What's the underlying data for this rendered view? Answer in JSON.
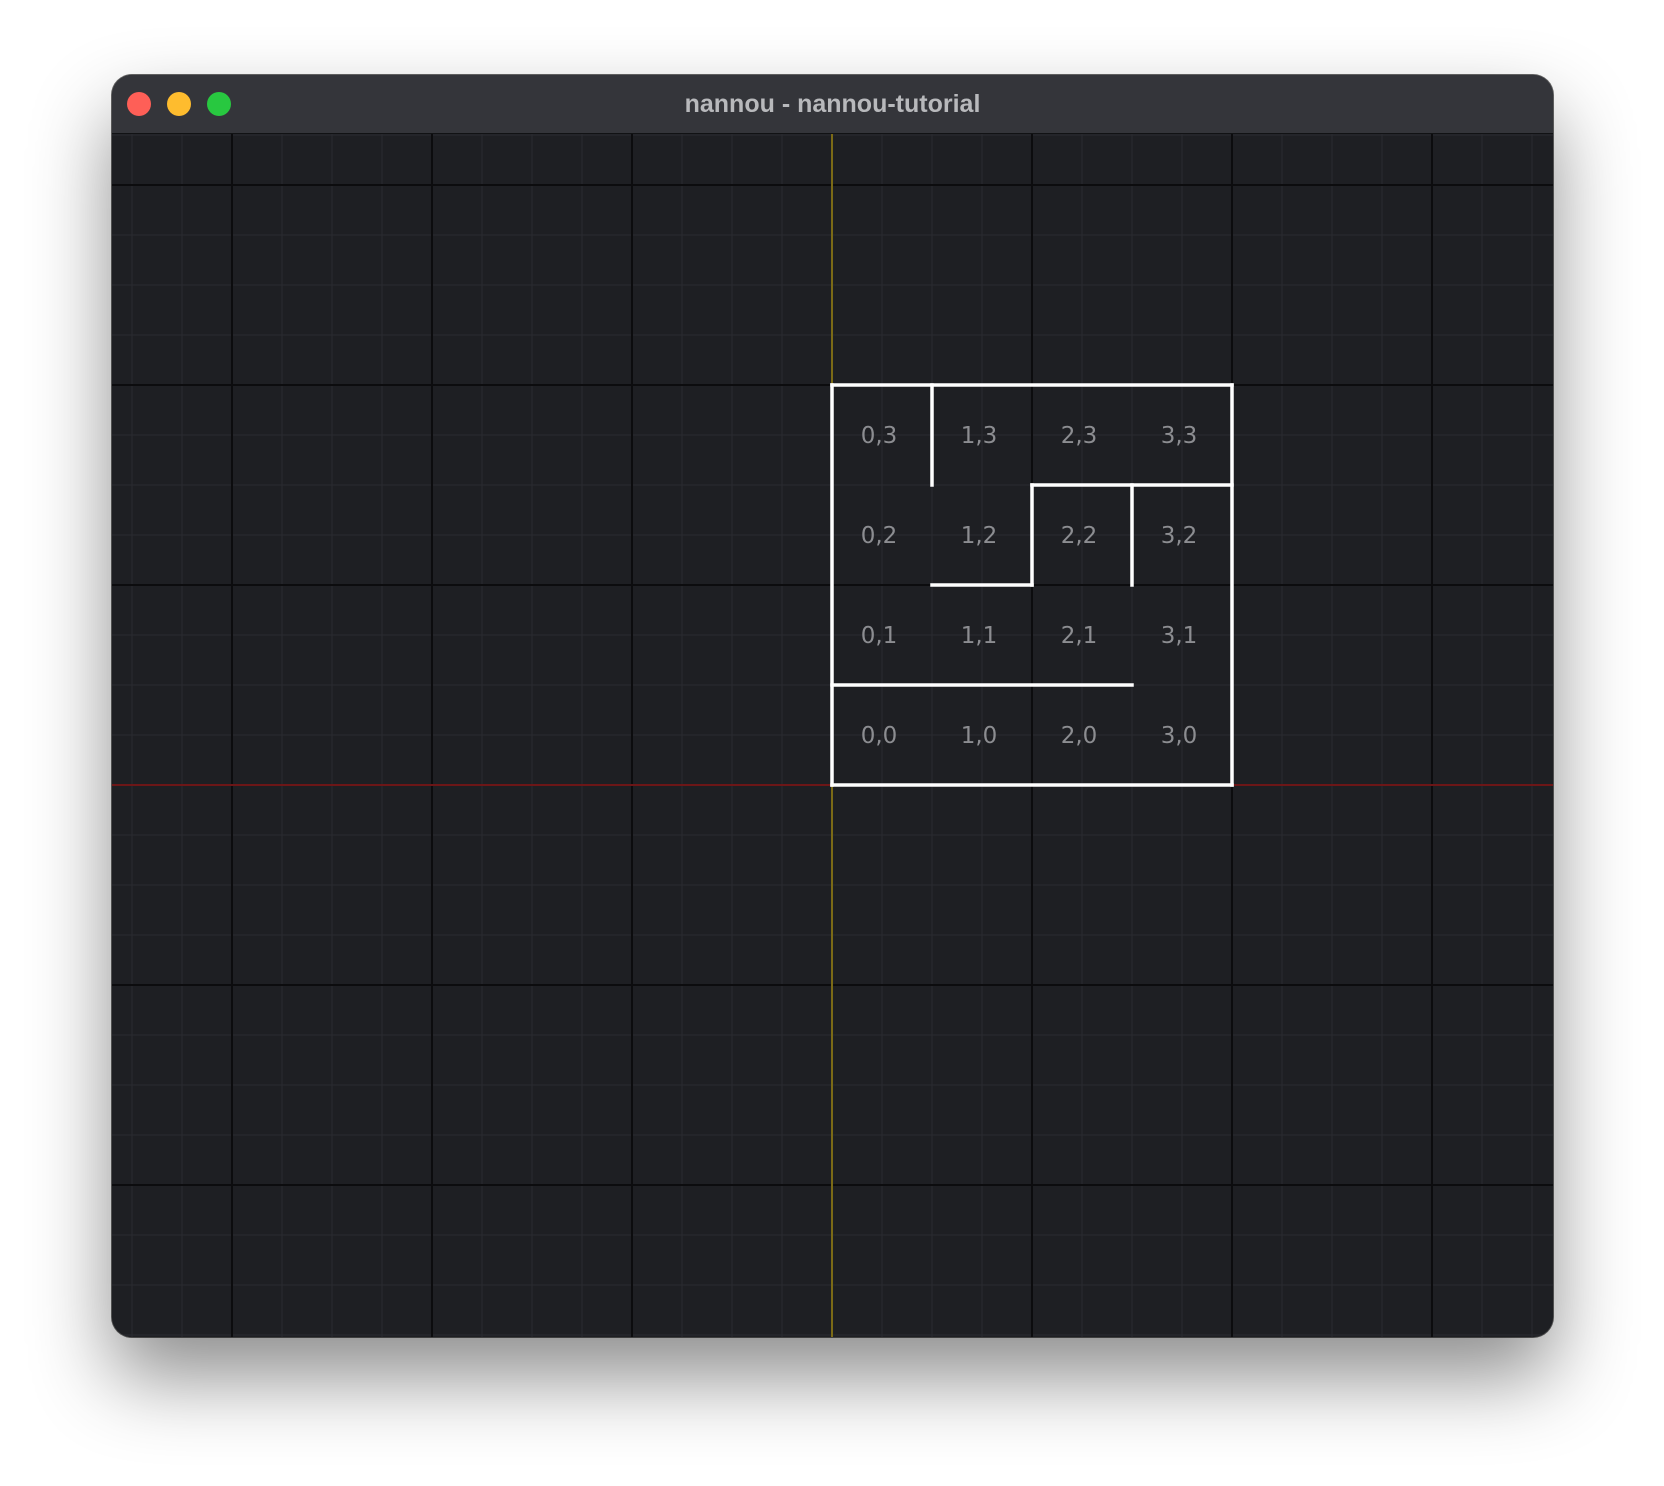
{
  "window": {
    "title": "nannou - nannou-tutorial",
    "controls": {
      "close_color": "#fe5f57",
      "minimize_color": "#febc2e",
      "maximize_color": "#28c840"
    }
  },
  "canvas": {
    "background": "#1e1f23",
    "minor_grid_color": "#2a2b30",
    "major_grid_color": "#0c0c0e",
    "x_axis_color": "#8c1a1a",
    "y_axis_color": "#a08a18",
    "maze_wall_color": "#ffffff"
  },
  "maze": {
    "rows": [
      [
        "0,3",
        "1,3",
        "2,3",
        "3,3"
      ],
      [
        "0,2",
        "1,2",
        "2,2",
        "3,2"
      ],
      [
        "0,1",
        "1,1",
        "2,1",
        "3,1"
      ],
      [
        "0,0",
        "1,0",
        "2,0",
        "3,0"
      ]
    ]
  }
}
